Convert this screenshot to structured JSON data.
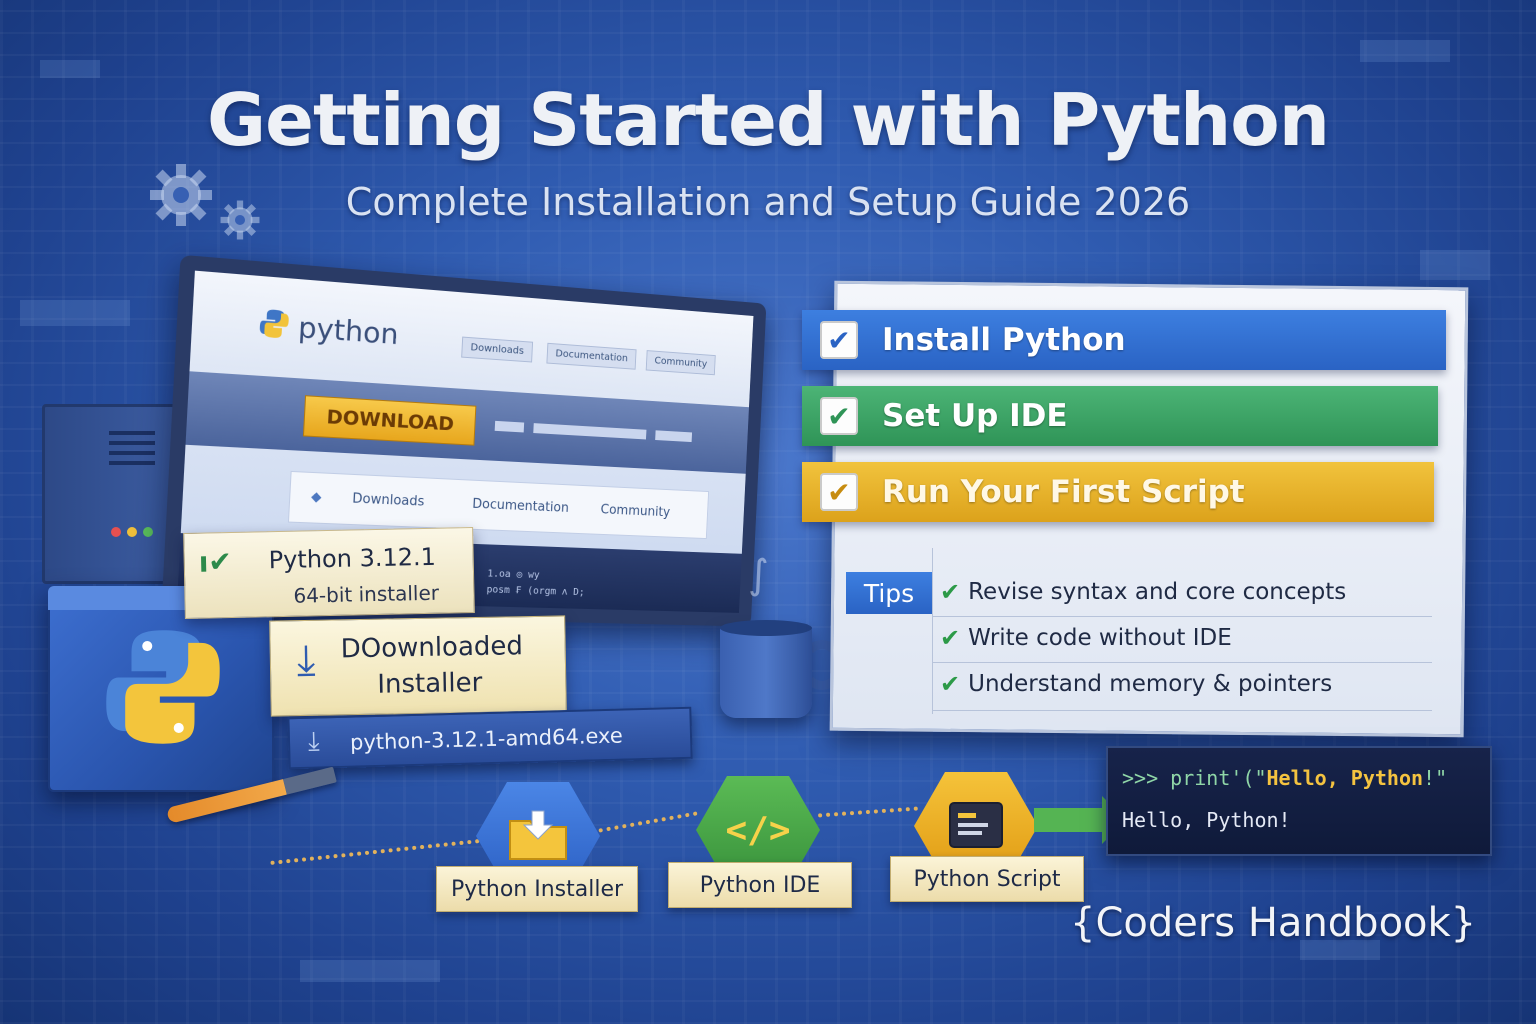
{
  "header": {
    "title": "Getting Started with Python",
    "subtitle": "Complete Installation and Setup Guide 2026"
  },
  "monitor": {
    "logo_text": "python",
    "nav_top": [
      "Downloads",
      "Documentation",
      "Community"
    ],
    "download_button": "DOWNLOAD",
    "nav_sub": [
      "Downloads",
      "Documentation",
      "Community"
    ],
    "scribble_1": "1.oa  ◎  wy",
    "scribble_2": "posm ₣ (orgm  ʌ  D;"
  },
  "installer": {
    "version": "Python 3.12.1",
    "bits": "64-bit installer",
    "downloaded_line1": "DOownloaded",
    "downloaded_line2": "Installer",
    "file_name": "python-3.12.1-amd64.exe"
  },
  "checklist": {
    "tasks": [
      {
        "label": "Install Python",
        "color": "#2a63c4"
      },
      {
        "label": "Set Up IDE",
        "color": "#2f9457"
      },
      {
        "label": "Run Your First Script",
        "color": "#dca21b"
      }
    ],
    "tips_label": "Tips",
    "tips": [
      "Revise syntax and core concepts",
      "Write code without IDE",
      "Understand memory & pointers"
    ]
  },
  "workflow": {
    "steps": [
      {
        "label": "Python Installer",
        "icon": "folder-download-icon"
      },
      {
        "label": "Python IDE",
        "icon": "code-tag-icon"
      },
      {
        "label": "Python Script",
        "icon": "script-window-icon"
      }
    ]
  },
  "terminal": {
    "prompt": ">>> print'(\"",
    "highlight": "Hello, Python",
    "prompt_end": "!\"",
    "output": "Hello, Python!"
  },
  "brand": "{Coders Handbook}"
}
